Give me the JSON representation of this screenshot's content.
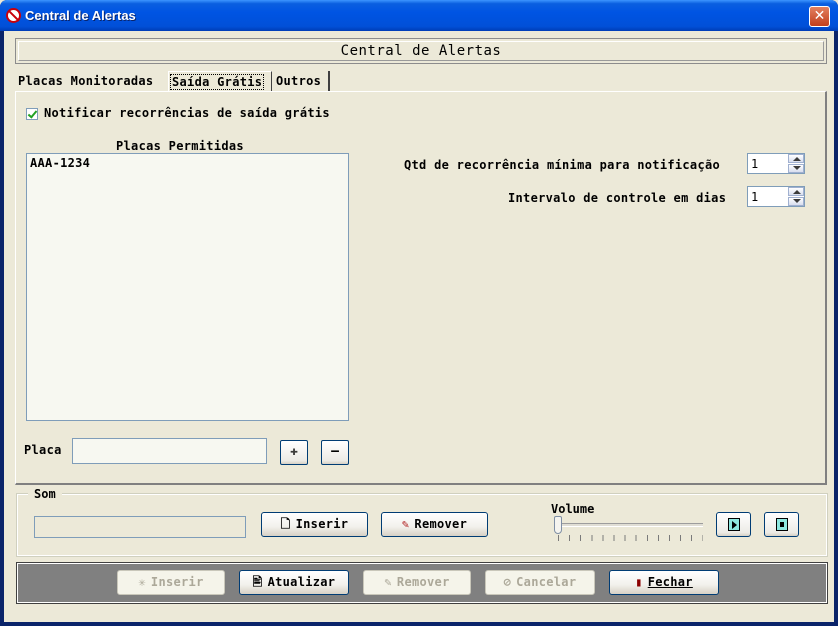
{
  "window": {
    "title": "Central de Alertas",
    "close_symbol": "✕"
  },
  "header": {
    "title": "Central de Alertas"
  },
  "tabs": [
    {
      "label": "Placas Monitoradas"
    },
    {
      "label": "Saída Grátis"
    },
    {
      "label": "Outros"
    }
  ],
  "saida_gratis": {
    "notify_checkbox_label": "Notificar recorrências de saída grátis",
    "notify_checked": true,
    "list_title": "Placas Permitidas",
    "plates": [
      "AAA-1234"
    ],
    "placa_label": "Placa",
    "placa_value": "",
    "add_symbol": "✚",
    "remove_symbol": "—",
    "min_recurrence_label": "Qtd de recorrência mínima para notificação",
    "min_recurrence_value": "1",
    "interval_label": "Intervalo de controle em dias",
    "interval_value": "1"
  },
  "som": {
    "legend": "Som",
    "file_value": "",
    "insert_label": "Inserir",
    "remove_label": "Remover",
    "volume_label": "Volume",
    "volume_level": 0
  },
  "footer": {
    "inserir_label": "Inserir",
    "atualizar_label": "Atualizar",
    "remover_label": "Remover",
    "cancelar_label": "Cancelar",
    "fechar_label": "Fechar"
  }
}
